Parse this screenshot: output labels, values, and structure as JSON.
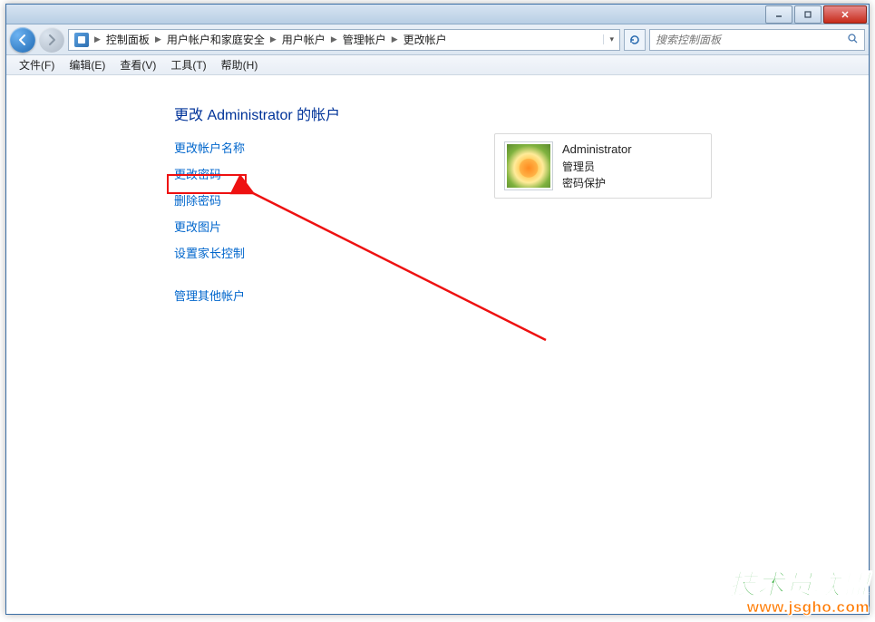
{
  "titlebar": {
    "min": "—",
    "max": "❐",
    "close": "✕"
  },
  "nav": {
    "breadcrumb": [
      "控制面板",
      "用户帐户和家庭安全",
      "用户帐户",
      "管理帐户",
      "更改帐户"
    ]
  },
  "search": {
    "placeholder": "搜索控制面板"
  },
  "menu": {
    "file": "文件(F)",
    "edit": "编辑(E)",
    "view": "查看(V)",
    "tools": "工具(T)",
    "help": "帮助(H)"
  },
  "page": {
    "heading": "更改 Administrator 的帐户",
    "links": {
      "rename": "更改帐户名称",
      "changepw": "更改密码",
      "removepw": "删除密码",
      "changepic": "更改图片",
      "parental": "设置家长控制",
      "other": "管理其他帐户"
    }
  },
  "account": {
    "name": "Administrator",
    "role": "管理员",
    "pw": "密码保护"
  },
  "watermark": {
    "line1": "技术员联盟",
    "line2": "www.jsgho.com"
  }
}
